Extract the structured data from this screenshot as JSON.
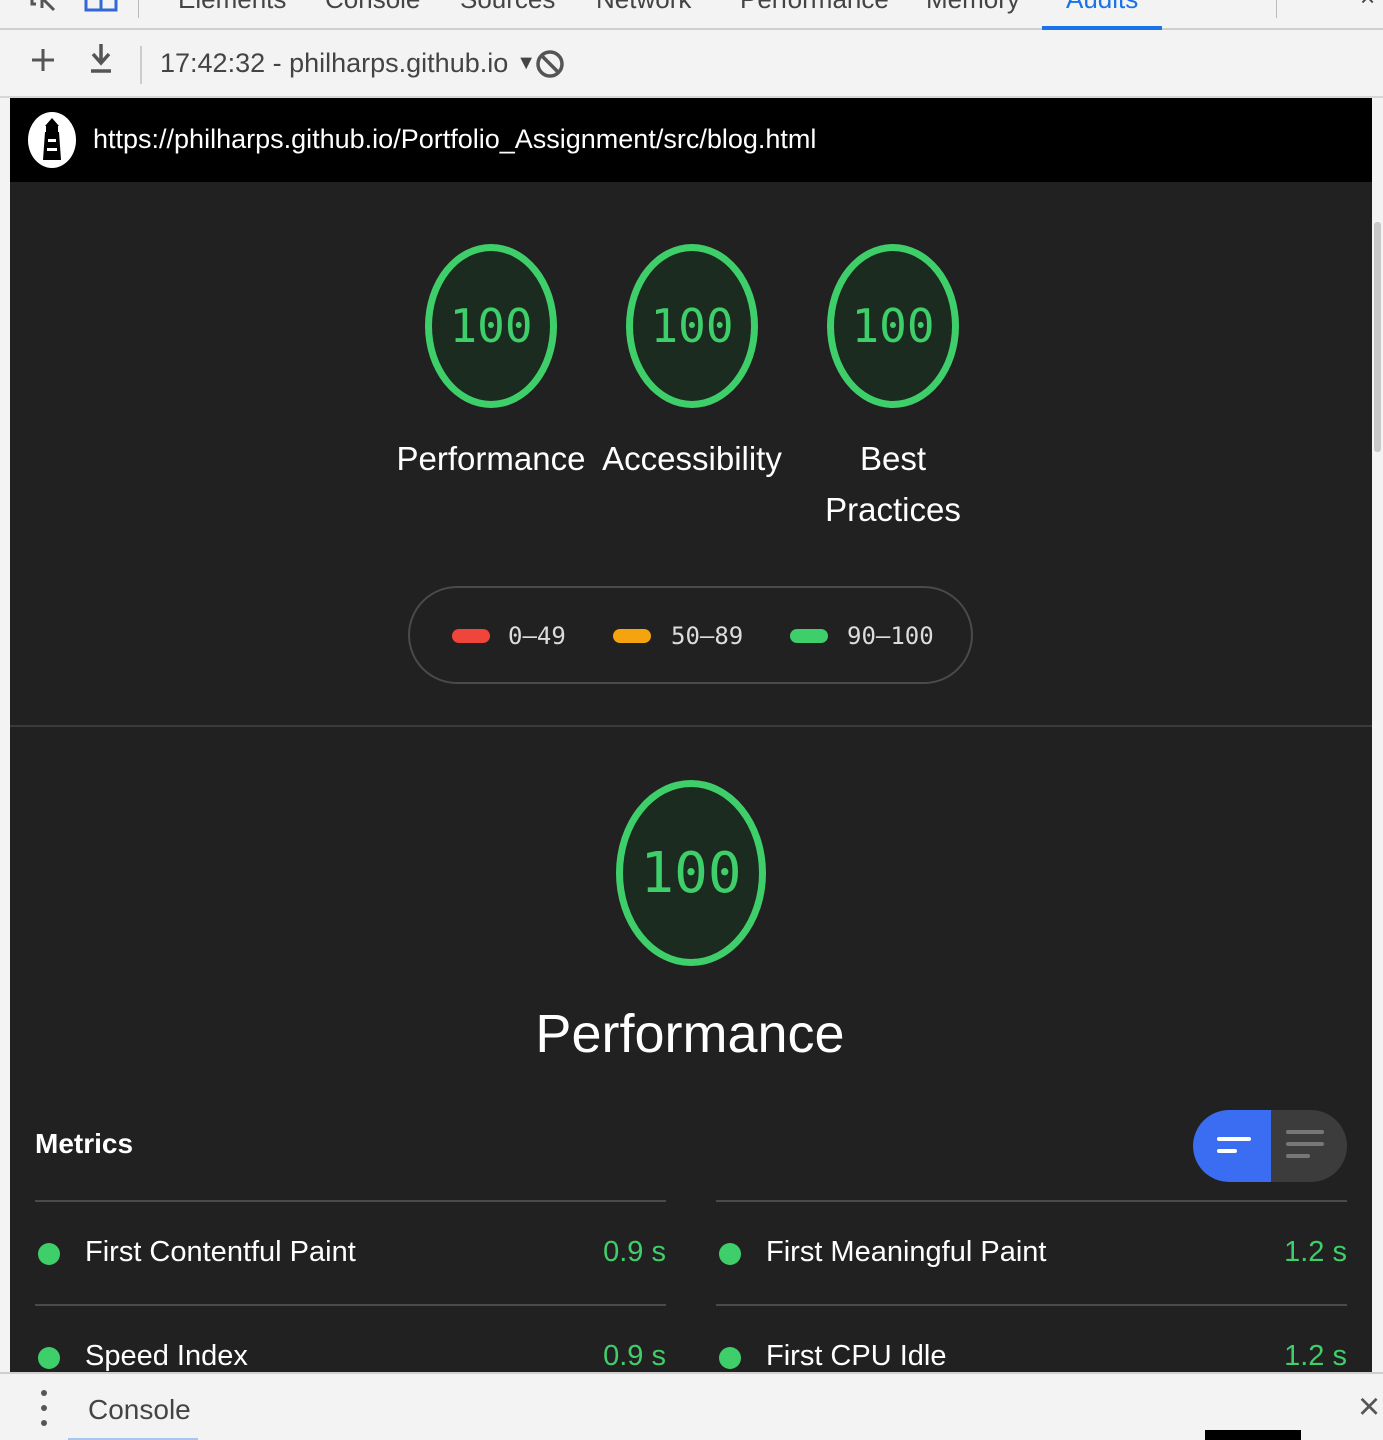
{
  "devtools": {
    "tabs": [
      "Elements",
      "Console",
      "Sources",
      "Network",
      "Performance",
      "Memory",
      "Audits"
    ],
    "active_tab": "Audits",
    "more_tabs_icon": "chevron-double-right",
    "close_glyph": "×"
  },
  "toolbar": {
    "new_audit_icon": "plus",
    "download_icon": "download",
    "report_label": "17:42:32 - philharps.github.io",
    "clear_icon": "block"
  },
  "report": {
    "url": "https://philharps.github.io/Portfolio_Assignment/src/blog.html",
    "categories": [
      {
        "score": "100",
        "label": "Performance"
      },
      {
        "score": "100",
        "label": "Accessibility"
      },
      {
        "score": "100",
        "label_line1": "Best",
        "label_line2": "Practices"
      }
    ],
    "legend": [
      {
        "range": "0–49",
        "color": "#f0453a"
      },
      {
        "range": "50–89",
        "color": "#f5a30f"
      },
      {
        "range": "90–100",
        "color": "#3fcf6a"
      }
    ],
    "performance_section": {
      "score": "100",
      "title": "Performance",
      "metrics_title": "Metrics",
      "metrics": [
        {
          "name": "First Contentful Paint",
          "value": "0.9 s"
        },
        {
          "name": "First Meaningful Paint",
          "value": "1.2 s"
        },
        {
          "name": "Speed Index",
          "value": "0.9 s"
        },
        {
          "name": "First CPU Idle",
          "value": "1.2 s"
        }
      ]
    },
    "colors": {
      "pass": "#3fcf6a",
      "background": "#212121",
      "accent": "#3b6df2"
    }
  },
  "drawer": {
    "tab_label": "Console",
    "close_glyph": "×"
  }
}
